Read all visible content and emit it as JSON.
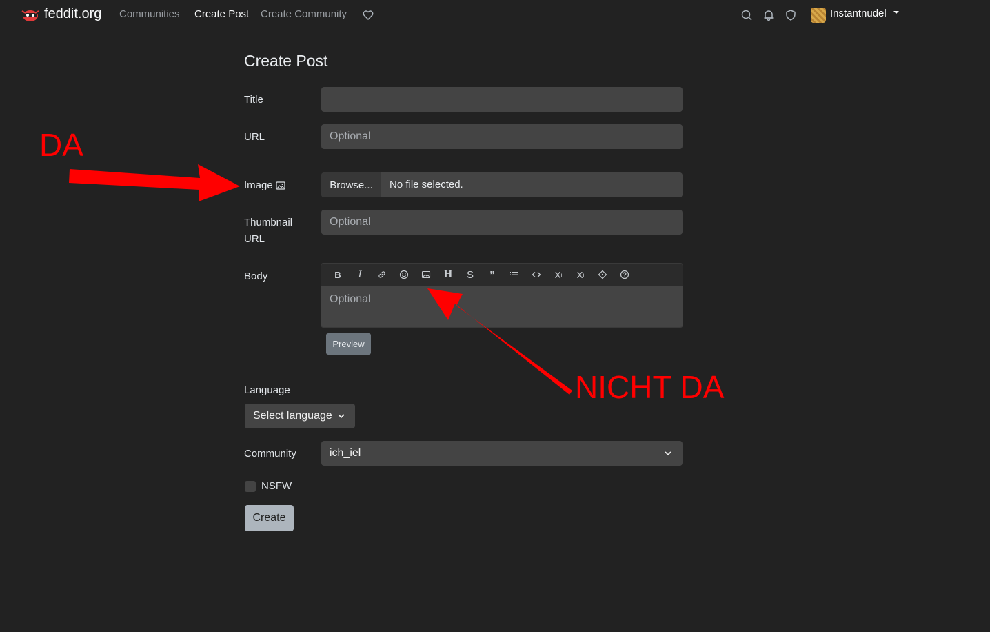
{
  "navbar": {
    "brand": "feddit.org",
    "links": [
      "Communities",
      "Create Post",
      "Create Community"
    ],
    "icons": [
      "heart-icon",
      "search-icon",
      "bell-icon",
      "shield-icon"
    ],
    "user_name": "Instantnudel"
  },
  "form": {
    "title": "Create Post",
    "labels": {
      "title": "Title",
      "url": "URL",
      "image": "Image",
      "thumbnail_line1": "Thumbnail",
      "thumbnail_line2": "URL",
      "body": "Body",
      "language": "Language",
      "community": "Community",
      "nsfw": "NSFW"
    },
    "url_placeholder": "Optional",
    "thumbnail_placeholder": "Optional",
    "body_placeholder": "Optional",
    "file_button": "Browse...",
    "file_status": "No file selected.",
    "preview_button": "Preview",
    "language_select": "Select language",
    "community_select": "ich_iel",
    "create_button": "Create",
    "toolbar_icons": [
      "bold-icon",
      "italic-icon",
      "link-icon",
      "emoji-icon",
      "image-icon",
      "header-icon",
      "strikethrough-icon",
      "quote-icon",
      "list-icon",
      "code-icon",
      "subscript-icon",
      "superscript-icon",
      "spoiler-icon",
      "help-icon"
    ]
  },
  "annotations": {
    "left_label": "DA",
    "right_label": "NICHT DA",
    "color": "#ff0000"
  }
}
